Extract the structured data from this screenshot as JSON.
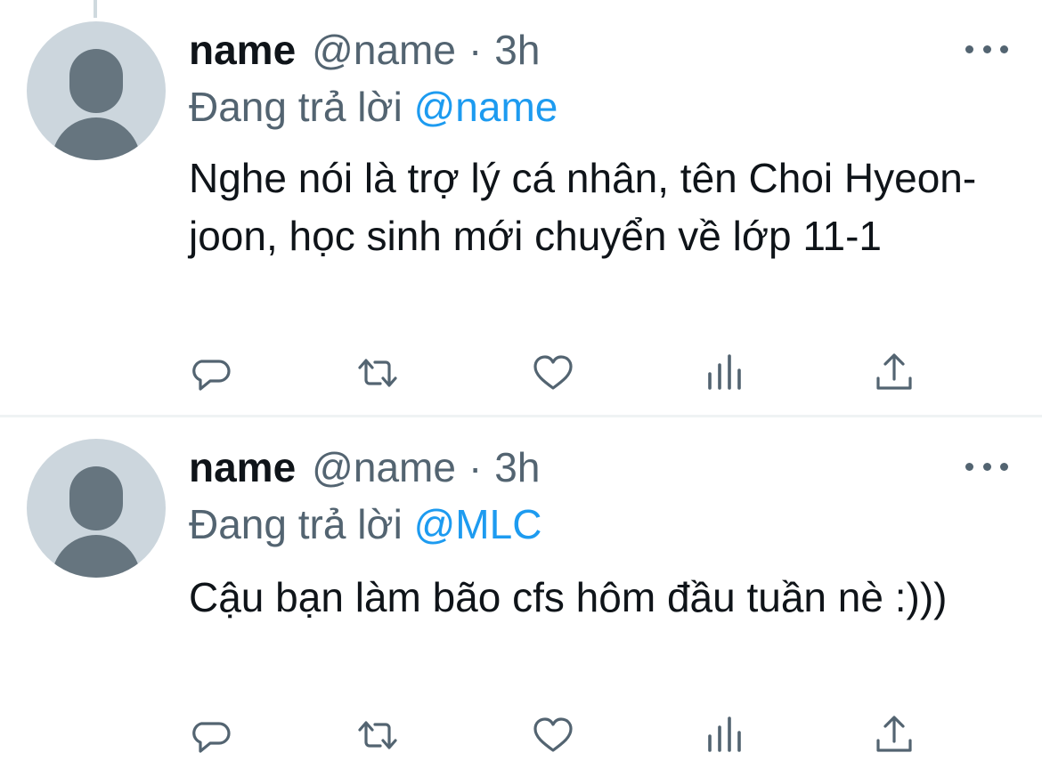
{
  "thread": {
    "tweets": [
      {
        "display_name": "name",
        "handle": "@name",
        "separator": "·",
        "time": "3h",
        "reply_prefix": "Đang trả lời",
        "reply_to": "@name",
        "text": "Nghe nói là trợ lý cá nhân, tên Choi Hyeon-joon, học sinh mới chuyển về lớp 11-1"
      },
      {
        "display_name": "name",
        "handle": "@name",
        "separator": "·",
        "time": "3h",
        "reply_prefix": "Đang trả lời",
        "reply_to": "@MLC",
        "text": "Cậu bạn làm bão cfs hôm đầu tuần nè :)))"
      }
    ]
  },
  "icons": {
    "more": "more-dots-icon",
    "reply": "reply-bubble-icon",
    "retweet": "retweet-icon",
    "like": "heart-icon",
    "stats": "analytics-bars-icon",
    "share": "share-upload-icon"
  },
  "colors": {
    "text_primary": "#0f1419",
    "text_secondary": "#536471",
    "link": "#1d9bf0",
    "avatar_bg": "#ccd6dd",
    "avatar_fg": "#66757f",
    "divider": "#eff3f4"
  }
}
